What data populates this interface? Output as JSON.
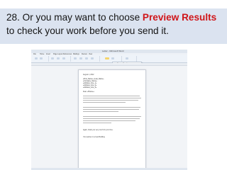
{
  "slide": {
    "heading_prefix": "28. Or you may want to choose ",
    "heading_highlight": "Preview Results",
    "heading_suffix": " to check your work before you send it."
  },
  "word": {
    "title": "Letter - Microsoft Word",
    "tabs": [
      "File",
      "Home",
      "Insert",
      "Page Layout",
      "References",
      "Mailings",
      "Review",
      "View"
    ],
    "dropdown_items": [
      "Preview Results",
      "Find Recipient"
    ],
    "document": {
      "date": "August 1, 2012",
      "fields": [
        "«First_Name» «Last_Name»",
        "«Company_Name»",
        "«Address_Line_1»",
        "«Address_Line_2»",
        "«Address_Line_3»"
      ],
      "salutation": "Dear «FName»:",
      "closing_1": "Again, thank you very much for your time.",
      "closing_2": "Your partner in a best Building"
    },
    "accent_color": "#f5d46b"
  },
  "colors": {
    "band": "#dbe3f0",
    "highlight": "#d0161a"
  }
}
